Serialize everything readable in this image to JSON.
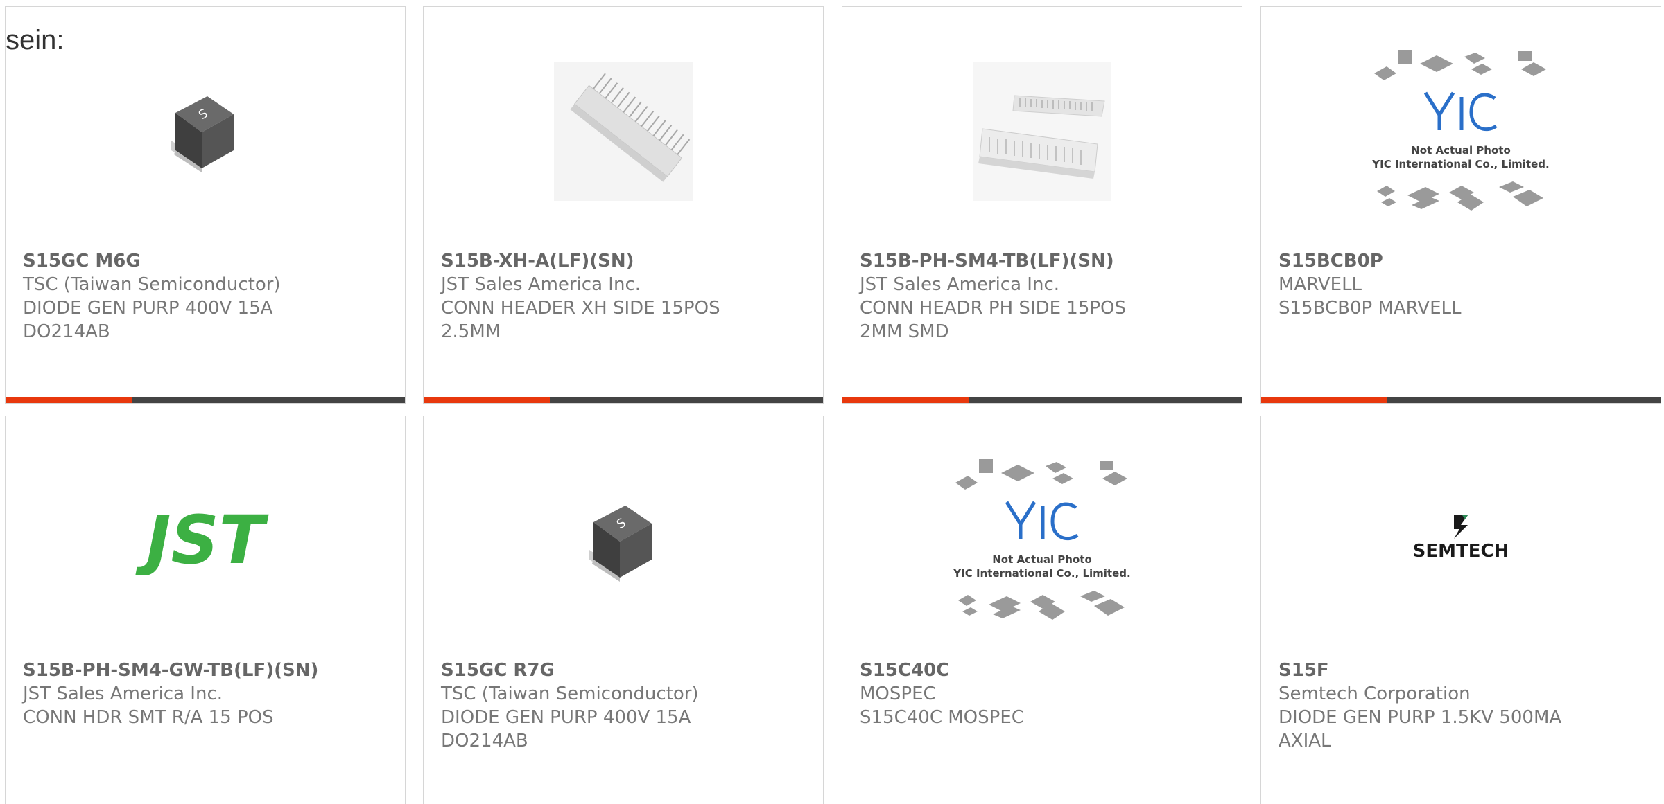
{
  "prefix_text": "sein:",
  "products": [
    {
      "part": "S15GC M6G",
      "manufacturer": "TSC (Taiwan Semiconductor)",
      "desc1": "DIODE GEN PURP 400V 15A",
      "desc2": "DO214AB",
      "image": "smd-diode-package"
    },
    {
      "part": "S15B-XH-A(LF)(SN)",
      "manufacturer": "JST Sales America Inc.",
      "desc1": "CONN HEADER XH SIDE 15POS",
      "desc2": "2.5MM",
      "image": "side-header-connector"
    },
    {
      "part": "S15B-PH-SM4-TB(LF)(SN)",
      "manufacturer": "JST Sales America Inc.",
      "desc1": "CONN HEADR PH SIDE 15POS",
      "desc2": "2MM SMD",
      "image": "smd-header-connector"
    },
    {
      "part": "S15BCB0P",
      "manufacturer": "MARVELL",
      "desc1": "S15BCB0P MARVELL",
      "desc2": "",
      "image": "not-actual-photo-placeholder",
      "placeholder_line1": "Not Actual Photo",
      "placeholder_line2": "YIC International Co., Limited."
    },
    {
      "part": "S15B-PH-SM4-GW-TB(LF)(SN)",
      "manufacturer": "JST Sales America Inc.",
      "desc1": "CONN HDR SMT R/A 15 POS",
      "desc2": "",
      "image": "jst-logo",
      "logo_text": "JST"
    },
    {
      "part": "S15GC R7G",
      "manufacturer": "TSC (Taiwan Semiconductor)",
      "desc1": "DIODE GEN PURP 400V 15A",
      "desc2": "DO214AB",
      "image": "smd-diode-package"
    },
    {
      "part": "S15C40C",
      "manufacturer": "MOSPEC",
      "desc1": "S15C40C MOSPEC",
      "desc2": "",
      "image": "not-actual-photo-placeholder",
      "placeholder_line1": "Not Actual Photo",
      "placeholder_line2": "YIC International Co., Limited."
    },
    {
      "part": "S15F",
      "manufacturer": "Semtech Corporation",
      "desc1": "DIODE GEN PURP 1.5KV 500MA",
      "desc2": "AXIAL",
      "image": "semtech-logo",
      "logo_text": "SEMTECH"
    }
  ],
  "colors": {
    "accent": "#e8380d",
    "bar": "#444444",
    "text": "#777777",
    "jst_green": "#3cb043"
  }
}
